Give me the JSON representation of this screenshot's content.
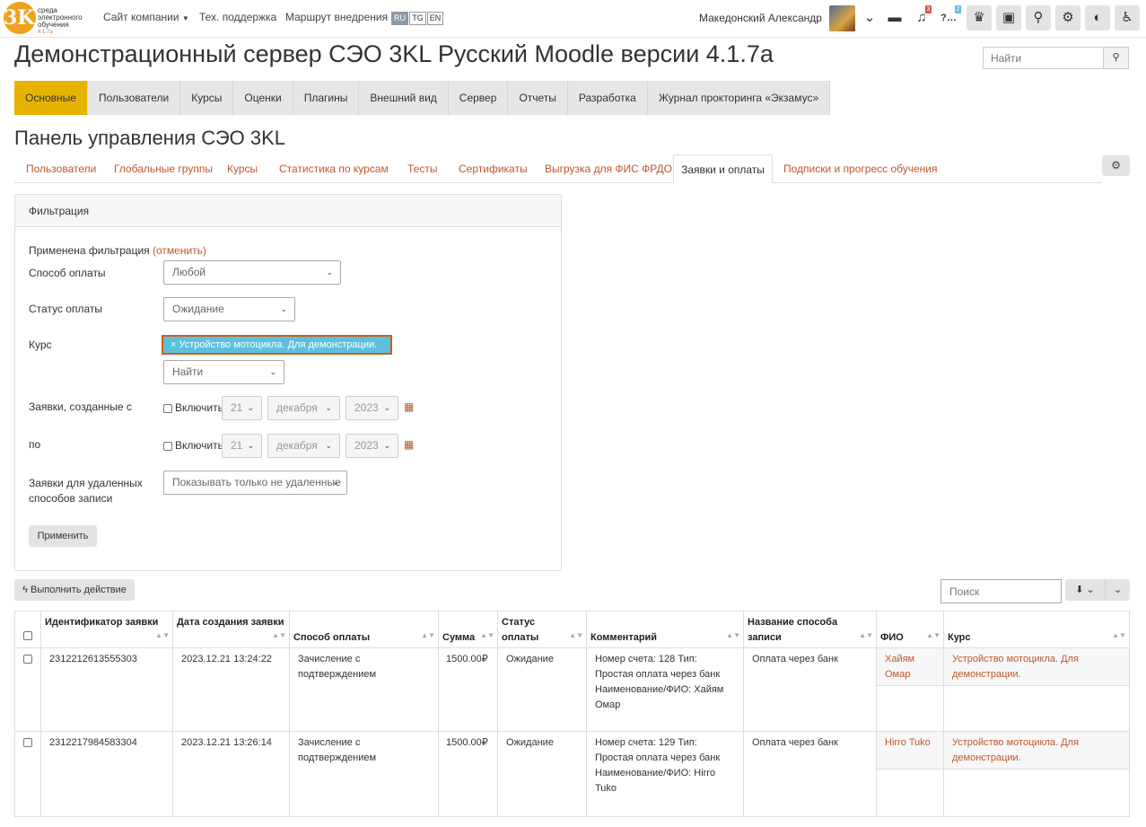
{
  "topbar": {
    "logo": {
      "line1": "среда",
      "line2": "электронного",
      "line3": "обучения",
      "version": "4.1.7a",
      "mark": "3KL"
    },
    "links": [
      "Сайт компании",
      "Тех. поддержка",
      "Маршрут внедрения"
    ],
    "langs": [
      "RU",
      "TG",
      "EN"
    ],
    "active_lang": "RU",
    "user_name": "Македонский Александр",
    "notification_count": "3",
    "help_count": "2",
    "icons": [
      "chevron-down-icon",
      "message-icon",
      "bell-icon",
      "help-icon",
      "trophy-icon",
      "tasks-icon",
      "search-icon",
      "gear-icon",
      "toggle-icon",
      "accessibility-icon"
    ]
  },
  "header": {
    "site_title": "Демонстрационный сервер СЭО 3KL Русский Moodle версии 4.1.7a",
    "search_placeholder": "Найти"
  },
  "main_tabs": [
    "Основные",
    "Пользователи",
    "Курсы",
    "Оценки",
    "Плагины",
    "Внешний вид",
    "Сервер",
    "Отчеты",
    "Разработка",
    "Журнал прокторинга «Экзамус»"
  ],
  "active_main_tab": "Основные",
  "panel_title": "Панель управления СЭО 3KL",
  "sub_tabs": [
    "Пользователи",
    "Глобальные группы",
    "Курсы",
    "Статистика по курсам",
    "Тесты",
    "Сертификаты",
    "Выгрузка для ФИС ФРДО",
    "Заявки и оплаты",
    "Подписки и прогресс обучения"
  ],
  "active_sub_tab": "Заявки и оплаты",
  "filter": {
    "title": "Фильтрация",
    "applied_text": "Применена фильтрация",
    "cancel_text": "(отменить)",
    "payment_method_label": "Способ оплаты",
    "payment_method_value": "Любой",
    "payment_status_label": "Статус оплаты",
    "payment_status_value": "Ожидание",
    "course_label": "Курс",
    "course_tag": "× Устройство мотоцикла. Для демонстрации.",
    "course_search": "Найти",
    "created_from_label": "Заявки, созданные с",
    "created_to_label": "по",
    "enable_label": "Включить",
    "from_day": "21",
    "from_month": "декабря",
    "from_year": "2023",
    "to_day": "21",
    "to_month": "декабря",
    "to_year": "2023",
    "deleted_label_1": "Заявки для удаленных",
    "deleted_label_2": "способов записи",
    "deleted_value": "Показывать только не удаленные",
    "apply_button": "Применить"
  },
  "actions": {
    "execute_button": "Выполнить действие",
    "table_search_placeholder": "Поиск"
  },
  "table": {
    "headers": [
      "Идентификатор заявки",
      "Дата создания заявки",
      "Способ оплаты",
      "Сумма",
      "Статус оплаты",
      "Комментарий",
      "Название способа записи",
      "ФИО",
      "Курс"
    ],
    "rows": [
      {
        "id": "2312212613555303",
        "date": "2023.12.21 13:24:22",
        "method": "Зачисление с подтверждением",
        "sum": "1500.00₽",
        "status": "Ожидание",
        "comment": "Номер счета: 128 Тип: Простая оплата через банк Наименование/ФИО: Хайям Омар",
        "enrol_name": "Оплата через банк",
        "fio": "Хайям Омар",
        "course": "Устройство мотоцикла. Для демонстрации."
      },
      {
        "id": "2312217984583304",
        "date": "2023.12.21 13:26:14",
        "method": "Зачисление с подтверждением",
        "sum": "1500.00₽",
        "status": "Ожидание",
        "comment": "Номер счета: 129 Тип: Простая оплата через банк Наименование/ФИО: Hirro Tuko",
        "enrol_name": "Оплата через банк",
        "fio": "Hirro Tuko",
        "course": "Устройство мотоцикла. Для демонстрации."
      }
    ]
  },
  "colors": {
    "accent": "#e6b400",
    "link": "#c0572a",
    "tag_bg": "#5bc0de"
  }
}
